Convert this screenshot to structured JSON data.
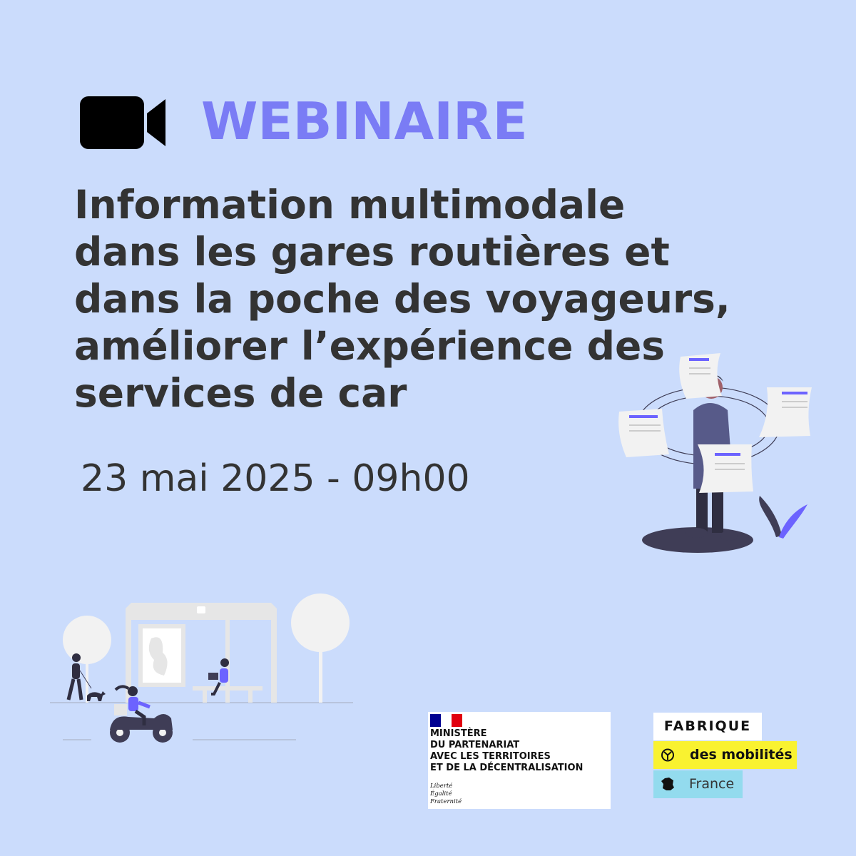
{
  "header": {
    "label": "WEBINAIRE",
    "icon": "video-camera-icon"
  },
  "title_lines": [
    "Information multimodale",
    "dans les gares routières et",
    "dans la poche des voyageurs,",
    "améliorer l’expérience des",
    "services de car"
  ],
  "event": {
    "date": "23 mai 2025 - 09h00"
  },
  "logos": {
    "ministere": {
      "lines": [
        "MINISTÈRE",
        "DU PARTENARIAT",
        "AVEC LES TERRITOIRES",
        "ET DE LA DÉCENTRALISATION"
      ],
      "motto": [
        "Liberté",
        "Égalité",
        "Fraternité"
      ]
    },
    "fabrique": {
      "top": "FABRIQUE",
      "middle": "des mobilités",
      "bottom": "France"
    }
  },
  "colors": {
    "background": "#cbdcfc",
    "accent": "#7a7cf5",
    "text": "#333333",
    "fabrique_yellow": "#f9f230",
    "fabrique_blue": "#93dbee"
  }
}
